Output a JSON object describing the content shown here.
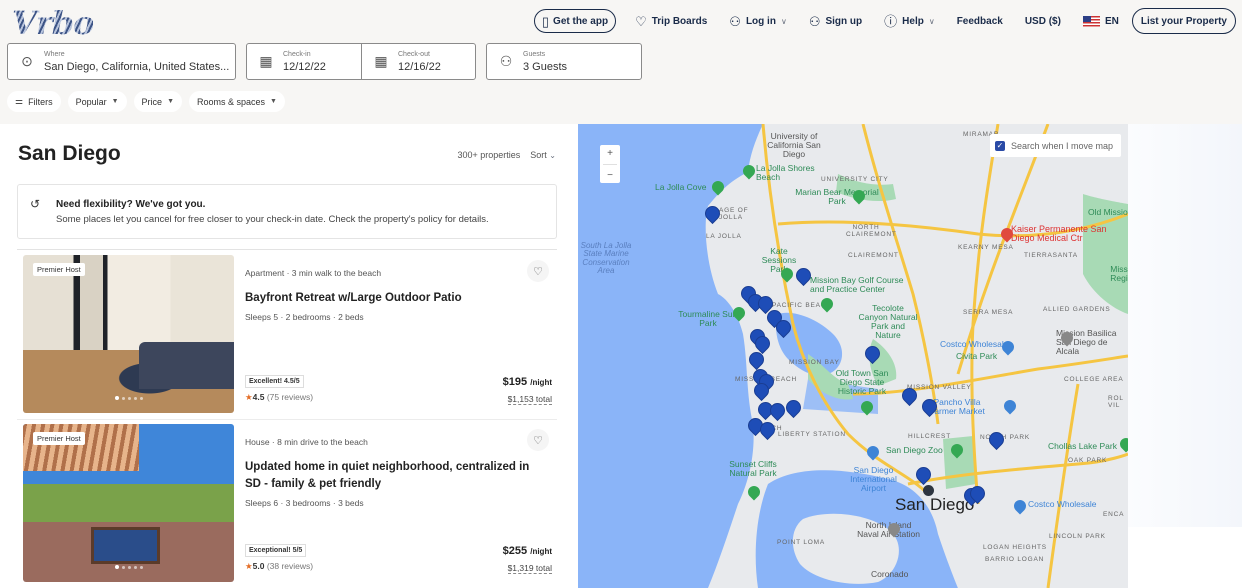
{
  "header": {
    "logo": "Vrbo",
    "nav": {
      "get_app": "Get the app",
      "trip_boards": "Trip Boards",
      "log_in": "Log in",
      "sign_up": "Sign up",
      "help": "Help",
      "feedback": "Feedback",
      "currency": "USD ($)",
      "language": "EN",
      "list_property": "List your Property"
    }
  },
  "search": {
    "where": {
      "label": "Where",
      "value": "San Diego, California, United States..."
    },
    "check_in": {
      "label": "Check-in",
      "value": "12/12/22"
    },
    "check_out": {
      "label": "Check-out",
      "value": "12/16/22"
    },
    "guests": {
      "label": "Guests",
      "value": "3 Guests"
    }
  },
  "filters": [
    {
      "label": "Filters"
    },
    {
      "label": "Popular"
    },
    {
      "label": "Price"
    },
    {
      "label": "Rooms & spaces"
    }
  ],
  "results": {
    "city": "San Diego",
    "count": "300+ properties",
    "sort_label": "Sort",
    "banner": {
      "title": "Need flexibility? We've got you.",
      "text": "Some places let you cancel for free closer to your check-in date. Check the property's policy for details."
    },
    "listings": [
      {
        "badge": "Premier Host",
        "meta": "Apartment · 3 min walk to the beach",
        "title": "Bayfront Retreat w/Large Outdoor Patio",
        "details": "Sleeps 5 · 2 bedrooms · 2 beds",
        "rating_badge": "Excellent! 4.5/5",
        "rating": "4.5",
        "reviews": "(75 reviews)",
        "price": "$195",
        "per": "/night",
        "total": "$1,153 total"
      },
      {
        "badge": "Premier Host",
        "meta": "House · 8 min drive to the beach",
        "title": "Updated home in quiet neighborhood, centralized in SD - family & pet friendly",
        "details": "Sleeps 6 · 3 bedrooms · 3 beds",
        "rating_badge": "Exceptional! 5/5",
        "rating": "5.0",
        "reviews": "(38 reviews)",
        "price": "$255",
        "per": "/night",
        "total": "$1,319 total"
      }
    ]
  },
  "map": {
    "zoom_in": "+",
    "zoom_out": "−",
    "search_when_move": "Search when I move map",
    "search_when_move_checked": true,
    "labels": {
      "ucsd": "University of California San Diego",
      "la_jolla_shores": "La Jolla Shores Beach",
      "la_jolla_cove": "La Jolla Cove",
      "village_la_jolla": "AGE OF JOLLA",
      "la_jolla": "LA JOLLA",
      "university_city": "UNIVERSITY CITY",
      "marian_bear": "Marian Bear Memorial Park",
      "miramar": "MIRAMAR",
      "south_la_jolla": "South La Jolla State Marine Conservation Area",
      "kate_sessions": "Kate Sessions Park",
      "north_clairemont": "NORTH CLAIREMONT",
      "clairemont": "CLAIREMONT",
      "kaiser": "Kaiser Permanente San Diego Medical Ctr",
      "kearny_mesa": "KEARNY MESA",
      "tierrasanta": "TIERRASANTA",
      "old_mission": "Old Missio",
      "tourmaline": "Tourmaline Surf Park",
      "pacific_beach": "PACIFIC BEACH",
      "mission_bay_golf": "Mission Bay Golf Course and Practice Center",
      "serra_mesa": "SERRA MESA",
      "allied_gardens": "ALLIED GARDENS",
      "tecolote": "Tecolote Canyon Natural Park and Nature",
      "costco1": "Costco Wholesale",
      "mission_basilica": "Mission Basilica San Diego de Alcala",
      "civita": "Civita Park",
      "mission_bay": "MISSION BAY",
      "mission_beach": "MISSION BEACH",
      "old_town": "Old Town San Diego State Historic Park",
      "mission_valley": "MISSION VALLEY",
      "college_area": "COLLEGE AREA",
      "pancho_villa": "Pancho Villa Farmer Market",
      "ocean_beach": "BEACH",
      "hillcrest": "HILLCREST",
      "north_park": "NORTH PARK",
      "chollas": "Chollas Lake Park",
      "oak_park": "OAK PARK",
      "liberty_station": "LIBERTY STATION",
      "sd_zoo": "San Diego Zoo",
      "sunset_cliffs": "Sunset Cliffs Natural Park",
      "sd_airport": "San Diego International Airport",
      "san_diego": "San Diego",
      "costco2": "Costco Wholesale",
      "north_island": "North Island Naval Air Station",
      "point_loma": "POINT LOMA",
      "logan_heights": "LOGAN HEIGHTS",
      "lincoln_park": "LINCOLN PARK",
      "barrio_logan": "BARRIO LOGAN",
      "coronado": "Coronado",
      "encanto": "ENCA",
      "rolando": "ROL VIL",
      "mission_reg": "Miss Regi"
    }
  }
}
